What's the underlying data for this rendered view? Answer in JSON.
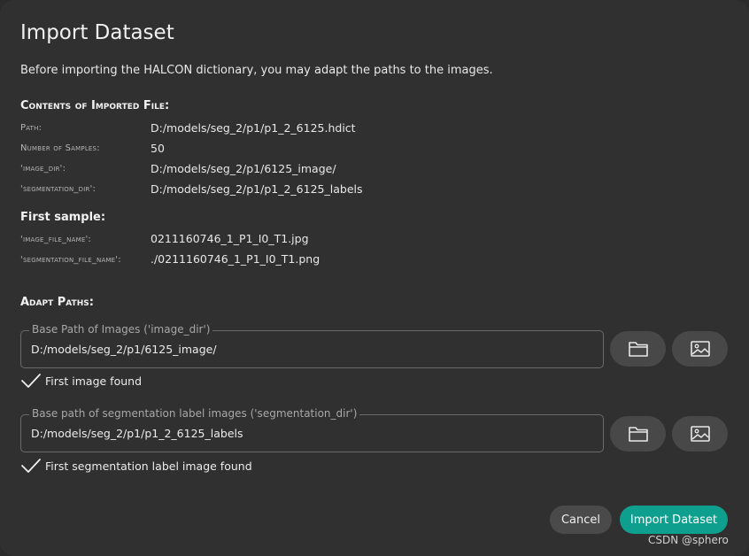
{
  "dialog": {
    "title": "Import Dataset",
    "intro": "Before importing the HALCON dictionary, you may adapt the paths to the images."
  },
  "contents": {
    "heading": "Contents of Imported File:",
    "rows": [
      {
        "label": "Path:",
        "value": "D:/models/seg_2/p1/p1_2_6125.hdict"
      },
      {
        "label": "Number of Samples:",
        "value": "50"
      },
      {
        "label": "'image_dir':",
        "value": "D:/models/seg_2/p1/6125_image/"
      },
      {
        "label": "'segmentation_dir':",
        "value": "D:/models/seg_2/p1/p1_2_6125_labels"
      }
    ]
  },
  "first_sample": {
    "heading": "First sample:",
    "rows": [
      {
        "label": "'image_file_name':",
        "value": "0211160746_1_P1_I0_T1.jpg"
      },
      {
        "label": "'segmentation_file_name':",
        "value": "./0211160746_1_P1_I0_T1.png"
      }
    ]
  },
  "adapt": {
    "heading": "Adapt Paths:",
    "image_dir": {
      "legend": "Base Path of Images ('image_dir')",
      "value": "D:/models/seg_2/p1/6125_image/",
      "status": "First image found"
    },
    "segmentation_dir": {
      "legend": "Base path of segmentation label images ('segmentation_dir')",
      "value": "D:/models/seg_2/p1/p1_2_6125_labels",
      "status": "First segmentation label image found"
    }
  },
  "buttons": {
    "cancel": "Cancel",
    "import": "Import Dataset"
  },
  "watermark": "CSDN @sphero",
  "colors": {
    "background": "#303030",
    "accent": "#0e9f8e",
    "secondary_button": "#4a4a4a"
  },
  "icons": [
    "folder-icon",
    "image-icon",
    "checkmark-icon"
  ]
}
